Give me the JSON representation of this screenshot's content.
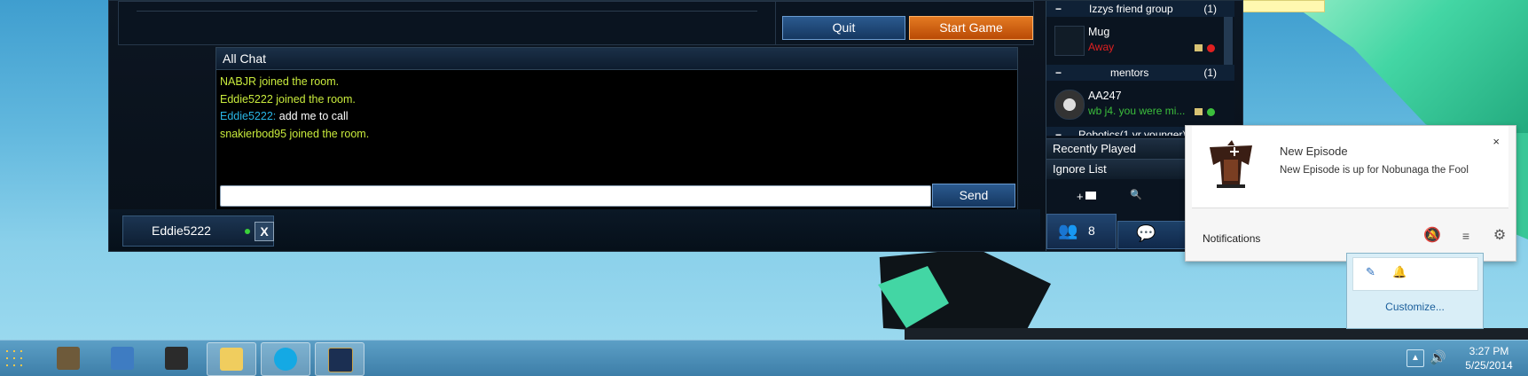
{
  "client": {
    "quit_label": "Quit",
    "start_label": "Start Game",
    "chat_title": "All Chat",
    "send_label": "Send",
    "chat_input_value": "",
    "chat_lines": [
      {
        "type": "system",
        "text": "NABJR joined the room."
      },
      {
        "type": "system",
        "text": "Eddie5222 joined the room."
      },
      {
        "type": "user",
        "user": "Eddie5222:",
        "text": " add me to call"
      },
      {
        "type": "system",
        "text": "snakierbod95 joined the room."
      }
    ],
    "user_tab_name": "Eddie5222",
    "user_tab_close": "X"
  },
  "friends": {
    "groups": [
      {
        "minus": "−",
        "name": "Izzys friend group",
        "count": "(1)"
      },
      {
        "minus": "−",
        "name": "mentors",
        "count": "(1)"
      },
      {
        "minus": "−",
        "name": "Robotics(1 yr younger)",
        "count": ""
      }
    ],
    "entries": [
      {
        "name": "Mug",
        "status": "Away",
        "status_color": "#e02020",
        "dot_color": "#e02020"
      },
      {
        "name": "AA247",
        "status": "wb j4. you were mi...",
        "status_color": "#3cbf3c",
        "dot_color": "#3cbf3c"
      }
    ],
    "sections": [
      "Recently Played",
      "Ignore List"
    ],
    "toolbar": {
      "add_folder": "+",
      "search_people": "🔍"
    },
    "online_count": "8"
  },
  "notification": {
    "title": "New Episode",
    "body": "New Episode is up for Nobunaga the Fool",
    "close": "×",
    "footer_label": "Notifications"
  },
  "tray_popup": {
    "customize": "Customize..."
  },
  "taskbar": {
    "items": [
      {
        "name": "sublime-text",
        "color": "#6e5a3a",
        "active": false
      },
      {
        "name": "notepad-pen",
        "color": "#3e7cc2",
        "active": false
      },
      {
        "name": "film-strip",
        "color": "#2b2b2b",
        "active": false
      },
      {
        "name": "folder",
        "color": "#f0cd5e",
        "active": true
      },
      {
        "name": "skype",
        "color": "#14a9e4",
        "active": true
      },
      {
        "name": "league-of-legends",
        "color": "#1b2f52",
        "active": true
      }
    ],
    "time": "3:27 PM",
    "date": "5/25/2014"
  }
}
